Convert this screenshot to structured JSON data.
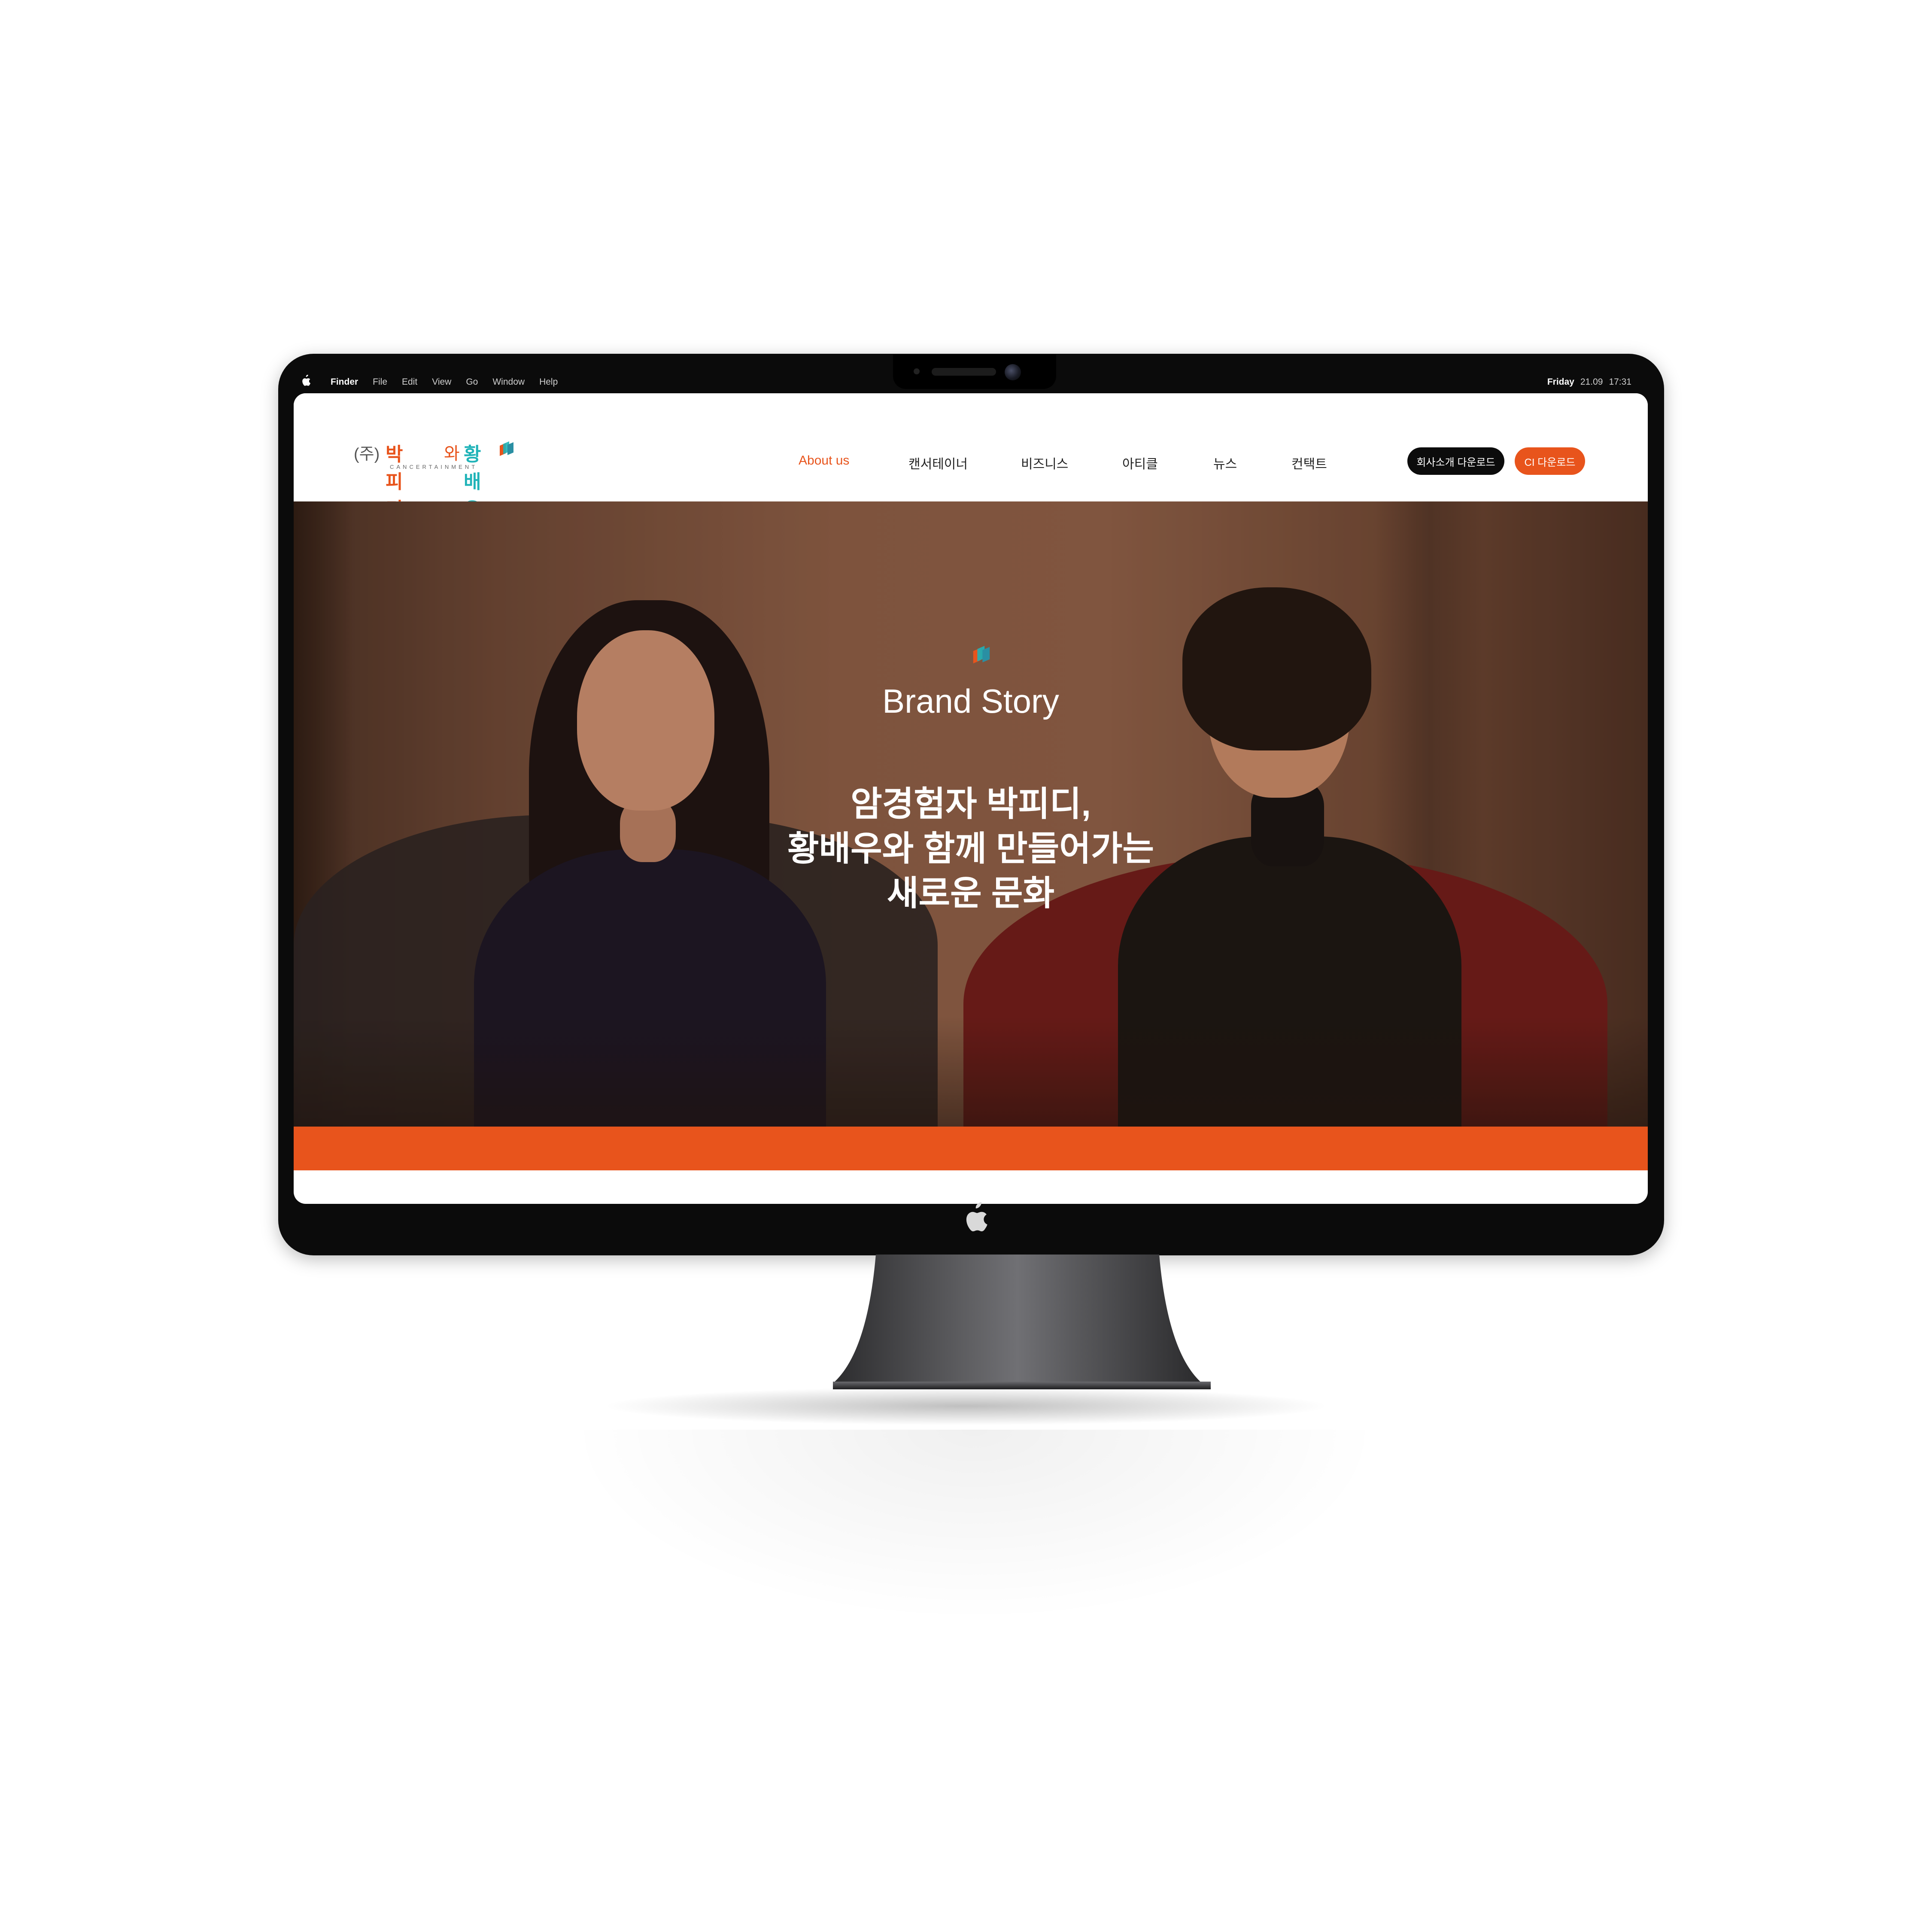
{
  "menubar": {
    "app_name": "Finder",
    "items": [
      "File",
      "Edit",
      "View",
      "Go",
      "Window",
      "Help"
    ],
    "day": "Friday",
    "date": "21.09",
    "time": "17:31"
  },
  "site": {
    "logo": {
      "corp_prefix": "(주)",
      "name_part1": "박피디",
      "name_connector": "와",
      "name_part2": "황배우",
      "subtitle": "CANCERTAINMENT"
    },
    "nav": [
      {
        "label": "About us",
        "active": true
      },
      {
        "label": "캔서테이너",
        "active": false
      },
      {
        "label": "비즈니스",
        "active": false
      },
      {
        "label": "아티클",
        "active": false
      },
      {
        "label": "뉴스",
        "active": false
      },
      {
        "label": "컨택트",
        "active": false
      }
    ],
    "buttons": {
      "company_download": "회사소개 다운로드",
      "ci_download": "CI 다운로드"
    },
    "hero": {
      "title": "Brand Story",
      "lines": [
        "암경험자 박피디,",
        "황배우와 함께 만들어가는",
        "새로운 문화"
      ]
    }
  },
  "colors": {
    "accent": "#e8541c",
    "teal": "#1fb3b8",
    "dark_button": "#0c0c0c",
    "bezel": "#0b0b0b"
  },
  "icons": {
    "menubar_logo": "apple-icon",
    "brand_mark": "book-stack-icon",
    "bezel_logo": "apple-icon"
  }
}
